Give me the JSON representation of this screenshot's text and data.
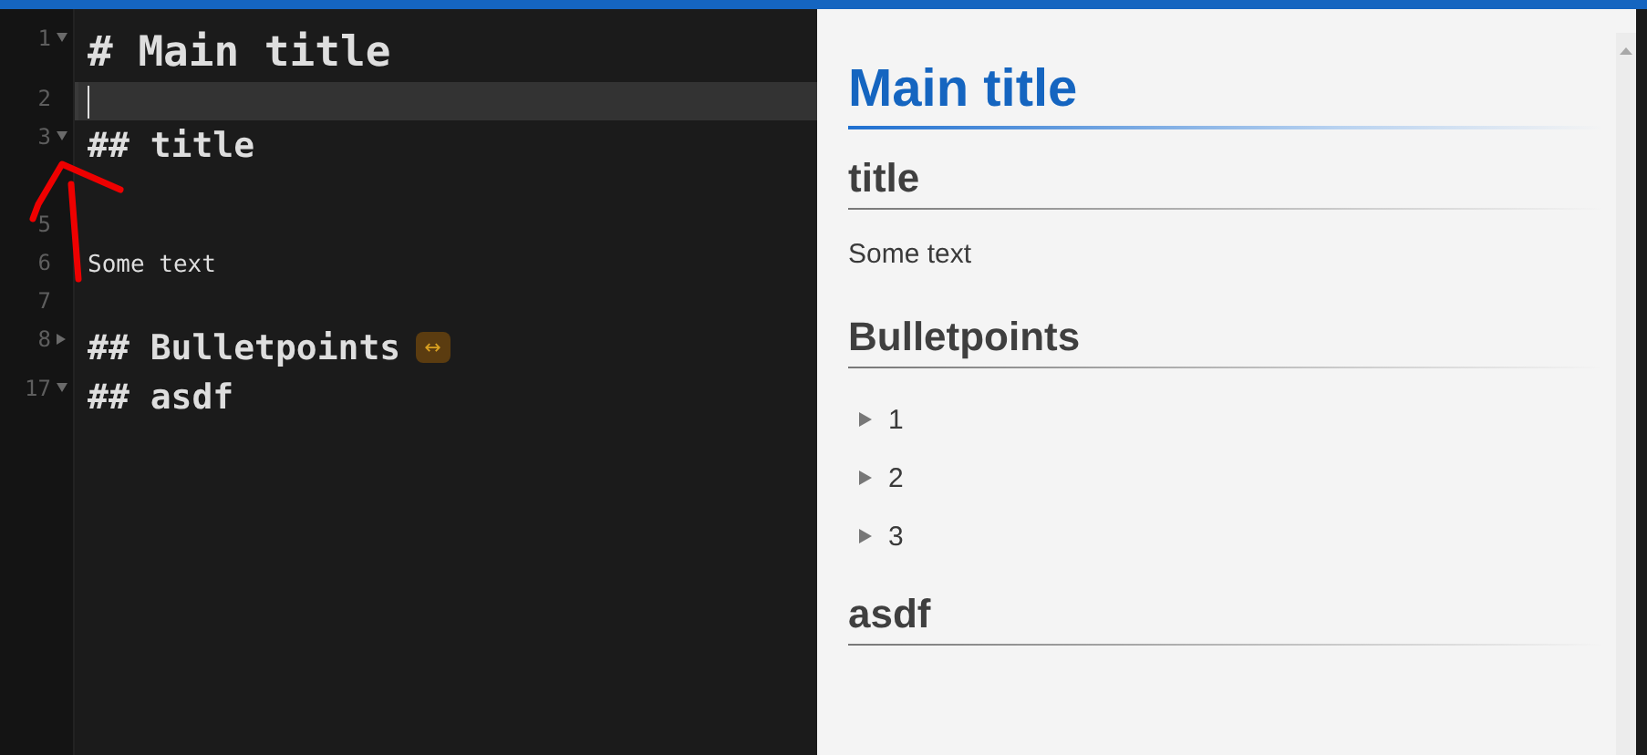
{
  "editor": {
    "lines": [
      {
        "number": "1",
        "kind": "h1",
        "text": "# Main title",
        "expanded": true,
        "current": false
      },
      {
        "number": "2",
        "kind": "blank",
        "current": true
      },
      {
        "number": "3",
        "kind": "h2",
        "text": "## title",
        "expanded": true,
        "current": false
      },
      {
        "kind": "blank",
        "current": false
      },
      {
        "number": "5",
        "kind": "blank",
        "current": false
      },
      {
        "number": "6",
        "kind": "text",
        "text": "Some text",
        "current": false
      },
      {
        "number": "7",
        "kind": "blank",
        "current": false
      },
      {
        "number": "8",
        "kind": "h2",
        "text": "## Bulletpoints",
        "expanded": false,
        "folded_badge": "↔",
        "current": false
      },
      {
        "number": "17",
        "kind": "h2",
        "text": "## asdf",
        "expanded": true,
        "current": false
      }
    ]
  },
  "preview": {
    "blocks": [
      {
        "kind": "h1",
        "text": "Main title"
      },
      {
        "kind": "h2",
        "text": "title"
      },
      {
        "kind": "p",
        "text": "Some text"
      },
      {
        "kind": "h2",
        "text": "Bulletpoints"
      },
      {
        "kind": "list",
        "items": [
          "1",
          "2",
          "3"
        ]
      },
      {
        "kind": "h2",
        "text": "asdf"
      }
    ]
  }
}
